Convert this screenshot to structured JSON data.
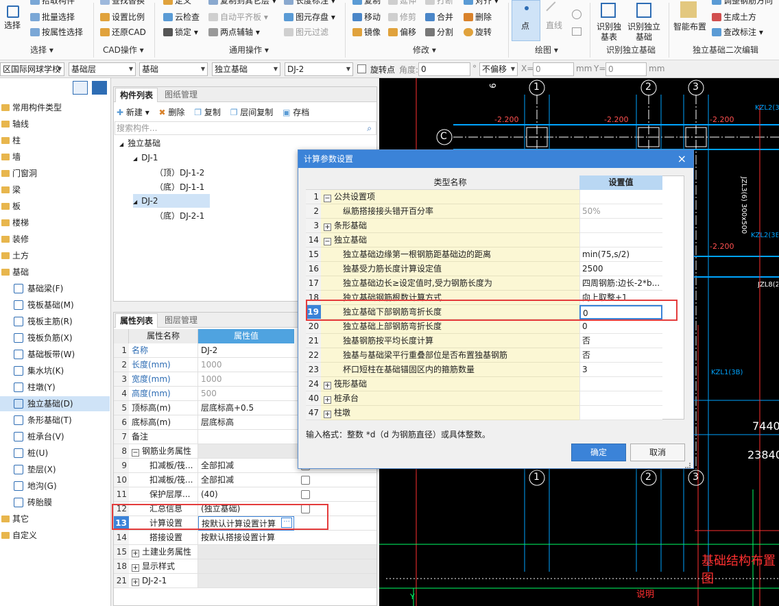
{
  "ribbon": {
    "select": {
      "label": "选择",
      "group": "选择 ▾",
      "items": [
        "拾取构件",
        "批量选择",
        "按属性选择"
      ]
    },
    "cad": {
      "group": "CAD操作 ▾",
      "items": [
        "查找替换",
        "设置比例",
        "还原CAD"
      ]
    },
    "common": {
      "group": "通用操作 ▾",
      "items": [
        "定义",
        "云检查",
        "锁定 ▾",
        "复制到其它层 ▾",
        "自动平齐板 ▾",
        "两点辅轴 ▾",
        "长度标注 ▾",
        "图元存盘 ▾",
        "图元过滤"
      ]
    },
    "modify": {
      "group": "修改 ▾",
      "items": [
        "复制",
        "延伸",
        "打断",
        "对齐 ▾",
        "移动",
        "修剪",
        "合并",
        "删除",
        "镜像",
        "偏移",
        "分割",
        "旋转"
      ]
    },
    "draw": {
      "group": "绘图 ▾",
      "point": "点",
      "line": "直线"
    },
    "identify": {
      "group": "识别独立基础",
      "items": [
        "识别独基表",
        "识别独立基础"
      ]
    },
    "edit2": {
      "group": "独立基础二次编辑",
      "smart": "智能布置",
      "items": [
        "调整钢筋方向",
        "生成土方",
        "查改标注 ▾"
      ]
    }
  },
  "toolbar": {
    "project": "区国际网球学校",
    "layer": "基础层",
    "category": "基础",
    "type": "独立基础",
    "name": "DJ-2",
    "rotate_label": "旋转点",
    "angle_label": "角度:",
    "angle_value": "0",
    "degree": "°",
    "offset": "不偏移",
    "x_label": "X=",
    "x_value": "0",
    "y_label": "Y=",
    "y_value": "0",
    "mm": "mm"
  },
  "left_tree": [
    {
      "label": "常用构件类型",
      "type": "folder"
    },
    {
      "label": "轴线",
      "type": "folder"
    },
    {
      "label": "柱",
      "type": "folder"
    },
    {
      "label": "墙",
      "type": "folder"
    },
    {
      "label": "门窗洞",
      "type": "folder"
    },
    {
      "label": "梁",
      "type": "folder"
    },
    {
      "label": "板",
      "type": "folder"
    },
    {
      "label": "楼梯",
      "type": "folder"
    },
    {
      "label": "装修",
      "type": "folder"
    },
    {
      "label": "土方",
      "type": "folder"
    },
    {
      "label": "基础",
      "type": "folder"
    },
    {
      "label": "基础梁(F)",
      "type": "child"
    },
    {
      "label": "筏板基础(M)",
      "type": "child"
    },
    {
      "label": "筏板主筋(R)",
      "type": "child"
    },
    {
      "label": "筏板负筋(X)",
      "type": "child"
    },
    {
      "label": "基础板带(W)",
      "type": "child"
    },
    {
      "label": "集水坑(K)",
      "type": "child"
    },
    {
      "label": "柱墩(Y)",
      "type": "child"
    },
    {
      "label": "独立基础(D)",
      "type": "child",
      "selected": true
    },
    {
      "label": "条形基础(T)",
      "type": "child"
    },
    {
      "label": "桩承台(V)",
      "type": "child"
    },
    {
      "label": "桩(U)",
      "type": "child"
    },
    {
      "label": "垫层(X)",
      "type": "child"
    },
    {
      "label": "地沟(G)",
      "type": "child"
    },
    {
      "label": "砖胎膜",
      "type": "child"
    },
    {
      "label": "其它",
      "type": "folder"
    },
    {
      "label": "自定义",
      "type": "folder"
    }
  ],
  "component_panel": {
    "tabs": [
      "构件列表",
      "图纸管理"
    ],
    "actions": [
      "新建 ▾",
      "删除",
      "复制",
      "层间复制",
      "存档"
    ],
    "search_placeholder": "搜索构件...",
    "tree": [
      {
        "label": "独立基础",
        "level": 0,
        "exp": "◢"
      },
      {
        "label": "DJ-1",
        "level": 1,
        "exp": "◢"
      },
      {
        "label": "（顶）DJ-1-2",
        "level": 2
      },
      {
        "label": "（底）DJ-1-1",
        "level": 2
      },
      {
        "label": "DJ-2",
        "level": 1,
        "exp": "◢",
        "selected": true
      },
      {
        "label": "（底）DJ-2-1",
        "level": 2
      }
    ]
  },
  "property_panel": {
    "tabs": [
      "属性列表",
      "图层管理"
    ],
    "headers": [
      "属性名称",
      "属性值"
    ],
    "rows": [
      {
        "n": "1",
        "name": "名称",
        "value": "DJ-2",
        "blue": true
      },
      {
        "n": "2",
        "name": "长度(mm)",
        "value": "1000",
        "blue": true,
        "gray": true
      },
      {
        "n": "3",
        "name": "宽度(mm)",
        "value": "1000",
        "blue": true,
        "gray": true
      },
      {
        "n": "4",
        "name": "高度(mm)",
        "value": "500",
        "blue": true,
        "gray": true
      },
      {
        "n": "5",
        "name": "顶标高(m)",
        "value": "层底标高+0.5"
      },
      {
        "n": "6",
        "name": "底标高(m)",
        "value": "层底标高"
      },
      {
        "n": "7",
        "name": "备注",
        "value": ""
      },
      {
        "n": "8",
        "name": "钢筋业务属性",
        "value": "",
        "exp": "−"
      },
      {
        "n": "9",
        "name": "扣减板/筏...",
        "value": "全部扣减",
        "indent": true,
        "check": true
      },
      {
        "n": "10",
        "name": "扣减板/筏...",
        "value": "全部扣减",
        "indent": true,
        "check": true
      },
      {
        "n": "11",
        "name": "保护层厚...",
        "value": "(40)",
        "indent": true,
        "check": true
      },
      {
        "n": "12",
        "name": "汇总信息",
        "value": "(独立基础)",
        "indent": true,
        "check": true
      },
      {
        "n": "13",
        "name": "计算设置",
        "value": "按默认计算设置计算",
        "indent": true,
        "selected": true
      },
      {
        "n": "14",
        "name": "搭接设置",
        "value": "按默认搭接设置计算",
        "indent": true
      },
      {
        "n": "15",
        "name": "土建业务属性",
        "value": "",
        "exp": "+"
      },
      {
        "n": "18",
        "name": "显示样式",
        "value": "",
        "exp": "+"
      },
      {
        "n": "21",
        "name": "DJ-2-1",
        "value": "",
        "exp": "+"
      }
    ]
  },
  "cad": {
    "axes_top": [
      "1",
      "2",
      "3"
    ],
    "axes_bottom": [
      "1",
      "2",
      "3"
    ],
    "axis_left": "C",
    "top_edge_label": "6",
    "elev_labels": [
      "-2.200",
      "-2.200",
      "-2.200",
      "-2.200"
    ],
    "beam_labels": [
      "KZL2(3",
      "JZL3(6) 300x500",
      "KZL2(3B",
      "JZL8(2",
      "KZL1(3B)"
    ],
    "dims": [
      "7440",
      "23840"
    ],
    "title": "基础结构布置图",
    "note": "说明",
    "y_axis": "Y"
  },
  "dialog": {
    "title": "计算参数设置",
    "close": "×",
    "headers": [
      "类型名称",
      "设置值"
    ],
    "rows": [
      {
        "n": "1",
        "name": "公共设置项",
        "value": "",
        "exp": "−",
        "group": true
      },
      {
        "n": "2",
        "name": "纵筋搭接接头错开百分率",
        "value": "50%",
        "gray": true
      },
      {
        "n": "3",
        "name": "条形基础",
        "value": "",
        "exp": "+",
        "group": true
      },
      {
        "n": "14",
        "name": "独立基础",
        "value": "",
        "exp": "−",
        "group": true
      },
      {
        "n": "15",
        "name": "独立基础边缘第一根钢筋距基础边的距离",
        "value": "min(75,s/2)"
      },
      {
        "n": "16",
        "name": "独基受力筋长度计算设定值",
        "value": "2500"
      },
      {
        "n": "17",
        "name": "独立基础边长≥设定值时,受力钢筋长度为",
        "value": "四周钢筋:边长-2*b..."
      },
      {
        "n": "18",
        "name": "独立基础钢筋根数计算方式",
        "value": "向上取整+1"
      },
      {
        "n": "19",
        "name": "独立基础下部钢筋弯折长度",
        "value": "0",
        "selected": true
      },
      {
        "n": "20",
        "name": "独立基础上部钢筋弯折长度",
        "value": "0"
      },
      {
        "n": "21",
        "name": "独基钢筋按平均长度计算",
        "value": "否"
      },
      {
        "n": "22",
        "name": "独基与基础梁平行重叠部位是否布置独基钢筋",
        "value": "否"
      },
      {
        "n": "23",
        "name": "杯口短柱在基础锚固区内的箍筋数量",
        "value": "3"
      },
      {
        "n": "24",
        "name": "筏形基础",
        "value": "",
        "exp": "+",
        "group": true
      },
      {
        "n": "40",
        "name": "桩承台",
        "value": "",
        "exp": "+",
        "group": true
      },
      {
        "n": "47",
        "name": "柱墩",
        "value": "",
        "exp": "+",
        "group": true
      }
    ],
    "hint": "输入格式：整数 *d（d 为钢筋直径）或具体整数。",
    "ok": "确定",
    "cancel": "取消"
  }
}
